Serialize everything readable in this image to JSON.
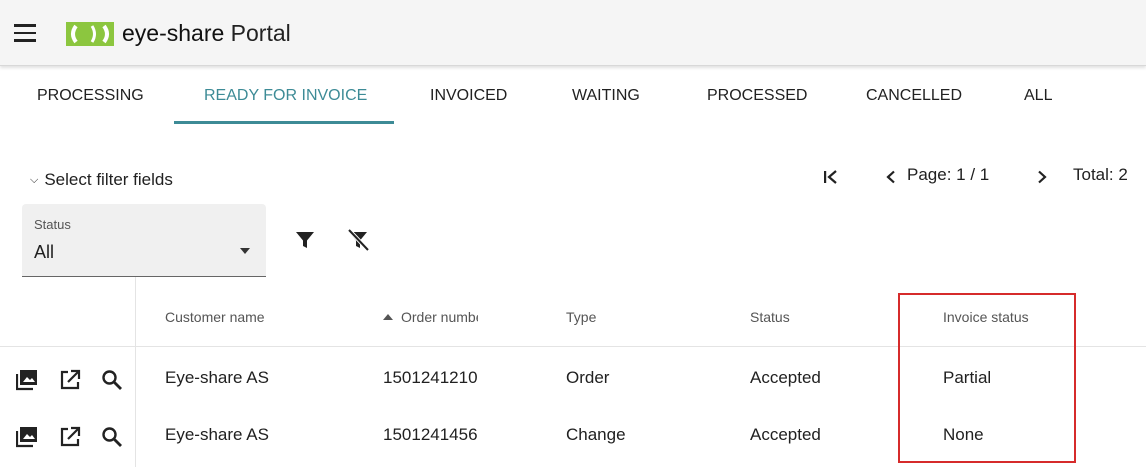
{
  "header": {
    "menu_icon": "hamburger-menu-icon",
    "logo_icon": "eye-share-logo",
    "brand_name": "eye-share",
    "brand_suffix": "Portal"
  },
  "tabs": [
    {
      "label": "PROCESSING",
      "active": false
    },
    {
      "label": "READY FOR INVOICE",
      "active": true
    },
    {
      "label": "INVOICED",
      "active": false
    },
    {
      "label": "WAITING",
      "active": false
    },
    {
      "label": "PROCESSED",
      "active": false
    },
    {
      "label": "CANCELLED",
      "active": false
    },
    {
      "label": "ALL",
      "active": false
    }
  ],
  "filters": {
    "toggle_label": "Select filter fields",
    "status_label": "Status",
    "status_value": "All",
    "apply_icon": "filter-icon",
    "clear_icon": "filter-off-icon"
  },
  "pager": {
    "first_icon": "first-page-icon",
    "prev_icon": "chevron-left-icon",
    "page_text": "Page: 1 / 1",
    "next_icon": "chevron-right-icon",
    "total_text": "Total: 2"
  },
  "table": {
    "columns": [
      "Customer name",
      "Order number",
      "Type",
      "Status",
      "Invoice status"
    ],
    "sorted_column": "Order number",
    "sort_direction": "ascending",
    "row_action_icons": [
      "image-icon",
      "open-in-new-icon",
      "search-icon"
    ],
    "rows": [
      {
        "customer": "Eye-share AS",
        "order": "1501241210",
        "type": "Order",
        "status": "Accepted",
        "invoice_status": "Partial"
      },
      {
        "customer": "Eye-share AS",
        "order": "1501241456",
        "type": "Change",
        "status": "Accepted",
        "invoice_status": "None"
      }
    ]
  },
  "colors": {
    "accent": "#3d8b96",
    "highlight_border": "#d62b2b",
    "logo_green": "#8cc63f"
  }
}
